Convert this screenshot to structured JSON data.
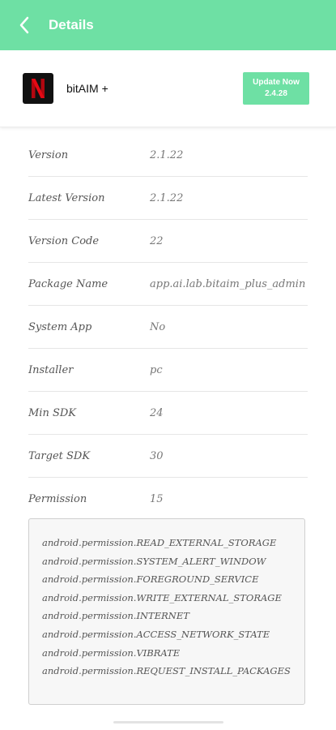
{
  "topbar": {
    "title": "Details",
    "background": "#6ee0a4"
  },
  "app": {
    "name": "bitAIM +",
    "icon": "netflix-n-icon",
    "update_button": {
      "line1": "Update Now",
      "line2": "2.4.28"
    }
  },
  "details": [
    {
      "label": "Version",
      "value": "2.1.22"
    },
    {
      "label": "Latest Version",
      "value": "2.1.22"
    },
    {
      "label": "Version Code",
      "value": "22"
    },
    {
      "label": "Package Name",
      "value": "app.ai.lab.bitaim_plus_admin"
    },
    {
      "label": "System App",
      "value": "No"
    },
    {
      "label": "Installer",
      "value": "pc"
    },
    {
      "label": "Min SDK",
      "value": "24"
    },
    {
      "label": "Target SDK",
      "value": "30"
    },
    {
      "label": "Permission",
      "value": "15"
    }
  ],
  "permissions": [
    "android.permission.READ_EXTERNAL_STORAGE",
    "android.permission.SYSTEM_ALERT_WINDOW",
    "android.permission.FOREGROUND_SERVICE",
    "android.permission.WRITE_EXTERNAL_STORAGE",
    "android.permission.INTERNET",
    "android.permission.ACCESS_NETWORK_STATE",
    "android.permission.VIBRATE",
    "android.permission.REQUEST_INSTALL_PACKAGES"
  ]
}
